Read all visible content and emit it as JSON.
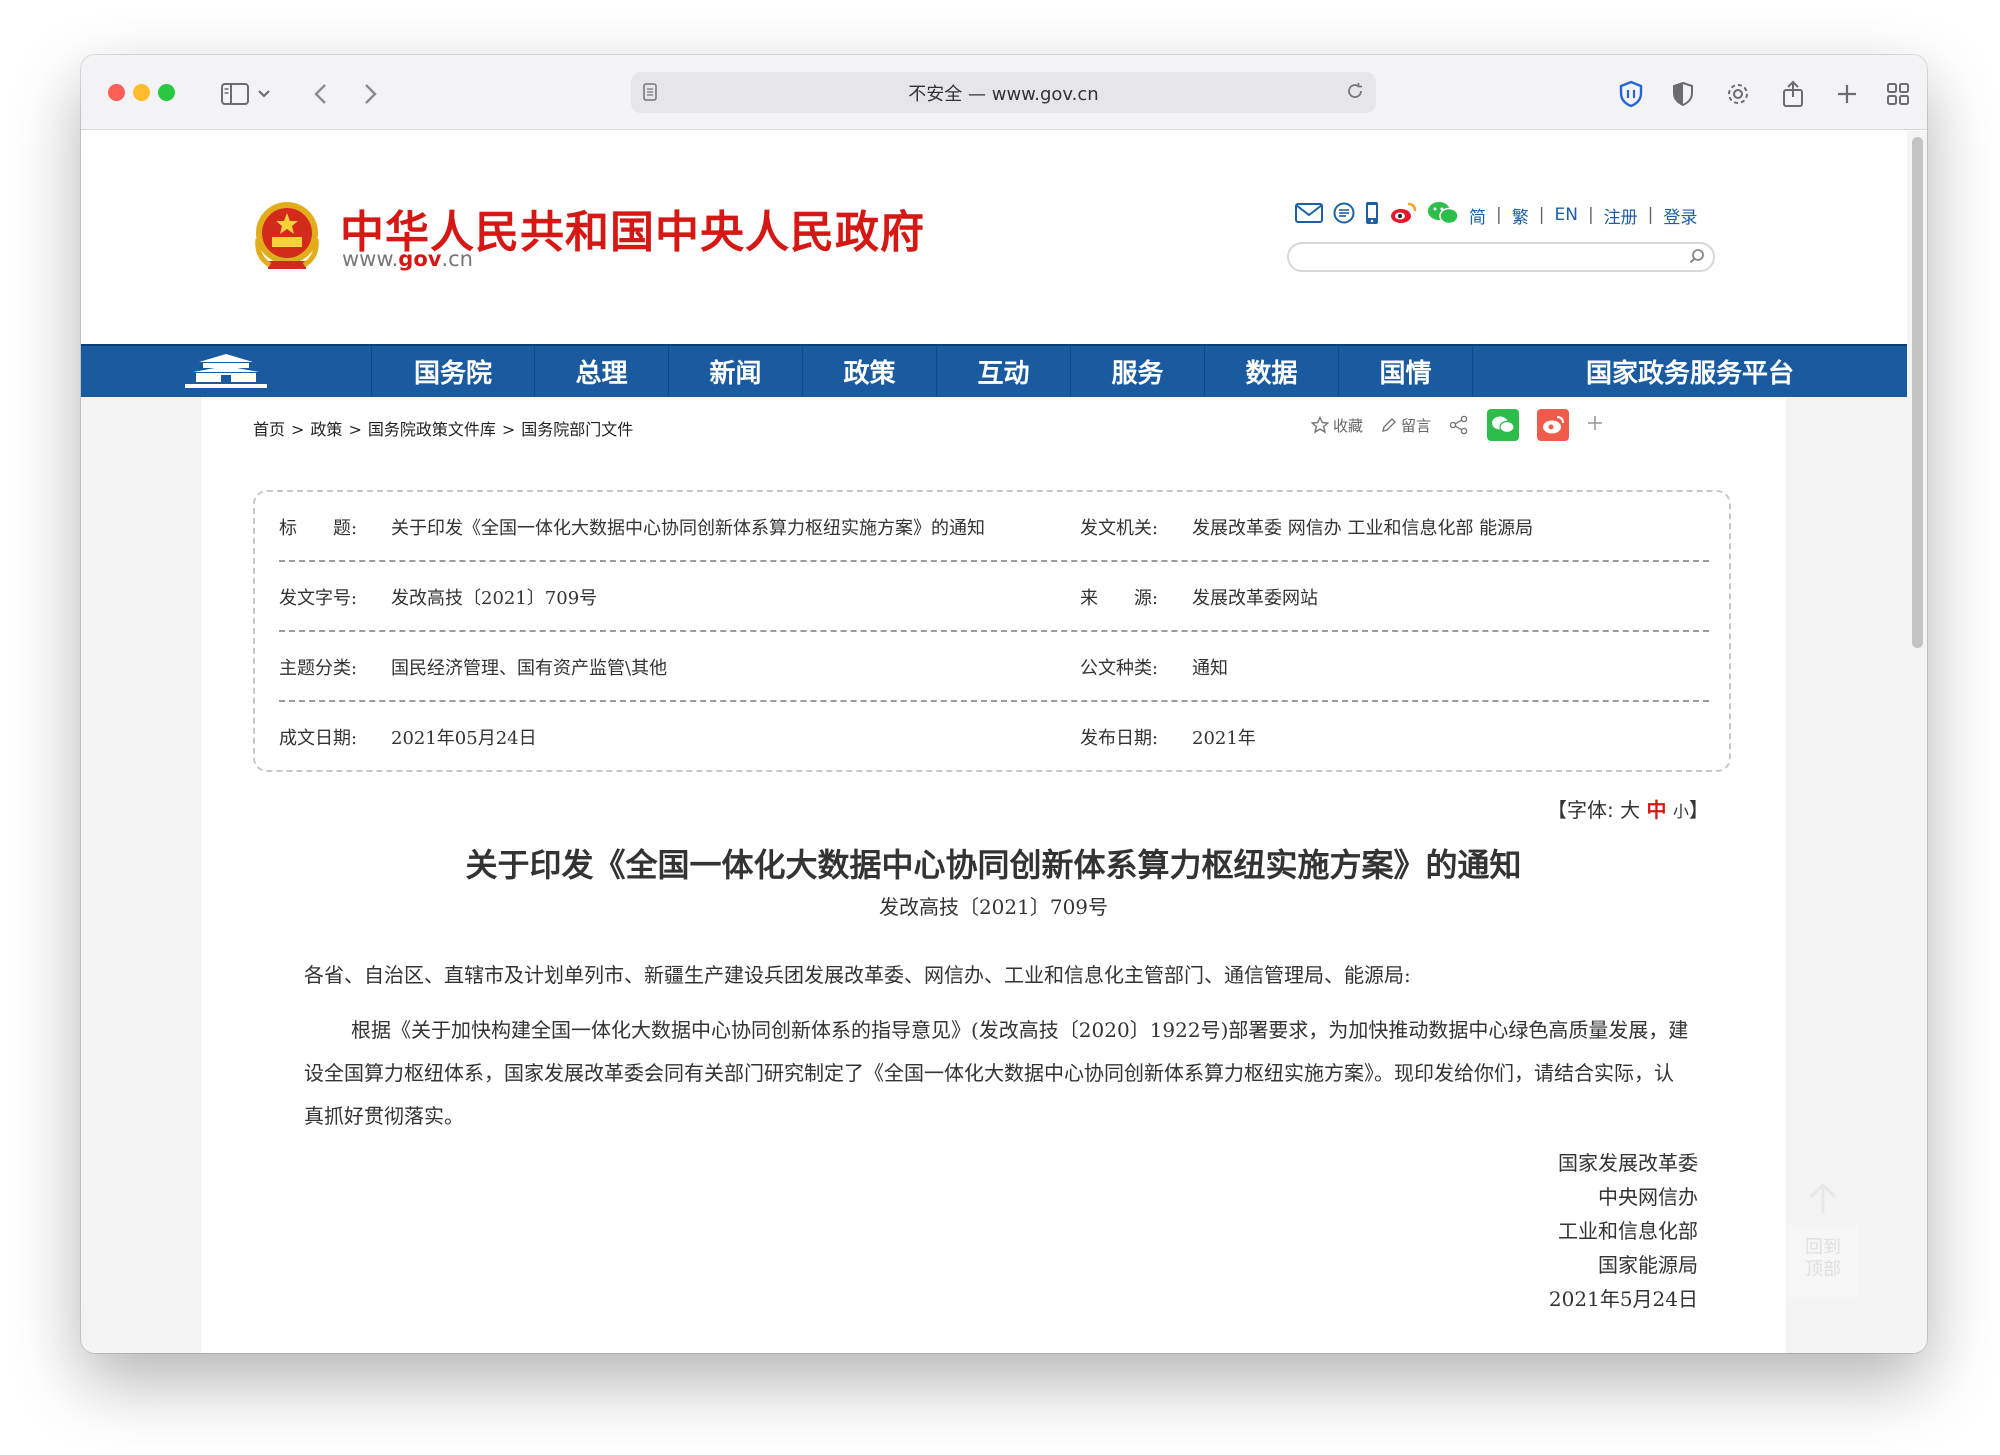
{
  "browser": {
    "address": "不安全 — www.gov.cn",
    "traffic_light_colors": {
      "close": "#ff5f57",
      "minimize": "#febc2e",
      "zoom": "#28c840"
    },
    "toolbar_icons": [
      "sidebar-icon",
      "chevron-down-icon",
      "back-icon",
      "forward-icon",
      "page-icon",
      "reload-icon",
      "shield-icon",
      "privacy-icon",
      "gear-icon",
      "share-icon",
      "plus-icon",
      "tabs-grid-icon"
    ]
  },
  "site": {
    "title": "中华人民共和国中央人民政府",
    "url_prefix": "www.",
    "url_brand": "gov",
    "url_suffix": ".cn",
    "brand_color": "#d51813",
    "nav_color": "#1a5a9e",
    "top_links": {
      "simplified": "简",
      "traditional": "繁",
      "english": "EN",
      "register": "注册",
      "login": "登录",
      "separator": "|"
    },
    "top_icons": [
      "mail-icon",
      "message-icon",
      "mobile-icon",
      "weibo-icon",
      "wechat-icon"
    ],
    "search_placeholder": ""
  },
  "nav": {
    "items": [
      "国务院",
      "总理",
      "新闻",
      "政策",
      "互动",
      "服务",
      "数据",
      "国情",
      "国家政务服务平台"
    ]
  },
  "breadcrumb": {
    "items": [
      "首页",
      ">",
      "政策",
      ">",
      "国务院政策文件库",
      ">",
      "国务院部门文件"
    ]
  },
  "share": {
    "favorite": "收藏",
    "comment": "留言",
    "wechat_color": "#2dbd4a",
    "weibo_color": "#f15b4c"
  },
  "meta": {
    "title_label": "标　　题:",
    "title_value": "关于印发《全国一体化大数据中心协同创新体系算力枢纽实施方案》的通知",
    "issuer_label": "发文机关:",
    "issuer_value": "发展改革委 网信办 工业和信息化部 能源局",
    "docno_label": "发文字号:",
    "docno_value": "发改高技〔2021〕709号",
    "source_label": "来　　源:",
    "source_value": "发展改革委网站",
    "topic_label": "主题分类:",
    "topic_value": "国民经济管理、国有资产监管\\其他",
    "type_label": "公文种类:",
    "type_value": "通知",
    "written_label": "成文日期:",
    "written_value": "2021年05月24日",
    "published_label": "发布日期:",
    "published_value": "2021年"
  },
  "font_size": {
    "open": "【字体:",
    "large": "大",
    "medium": "中",
    "small": "小",
    "close": "】"
  },
  "document": {
    "title": "关于印发《全国一体化大数据中心协同创新体系算力枢纽实施方案》的通知",
    "number": "发改高技〔2021〕709号",
    "salutation": "各省、自治区、直辖市及计划单列市、新疆生产建设兵团发展改革委、网信办、工业和信息化主管部门、通信管理局、能源局:",
    "body": "根据《关于加快构建全国一体化大数据中心协同创新体系的指导意见》(发改高技〔2020〕1922号)部署要求，为加快推动数据中心绿色高质量发展，建设全国算力枢纽体系，国家发展改革委会同有关部门研究制定了《全国一体化大数据中心协同创新体系算力枢纽实施方案》。现印发给你们，请结合实际，认真抓好贯彻落实。",
    "signatories": [
      "国家发展改革委",
      "中央网信办",
      "工业和信息化部",
      "国家能源局"
    ],
    "date": "2021年5月24日"
  },
  "back_to_top": {
    "line1": "回到",
    "line2": "顶部"
  }
}
